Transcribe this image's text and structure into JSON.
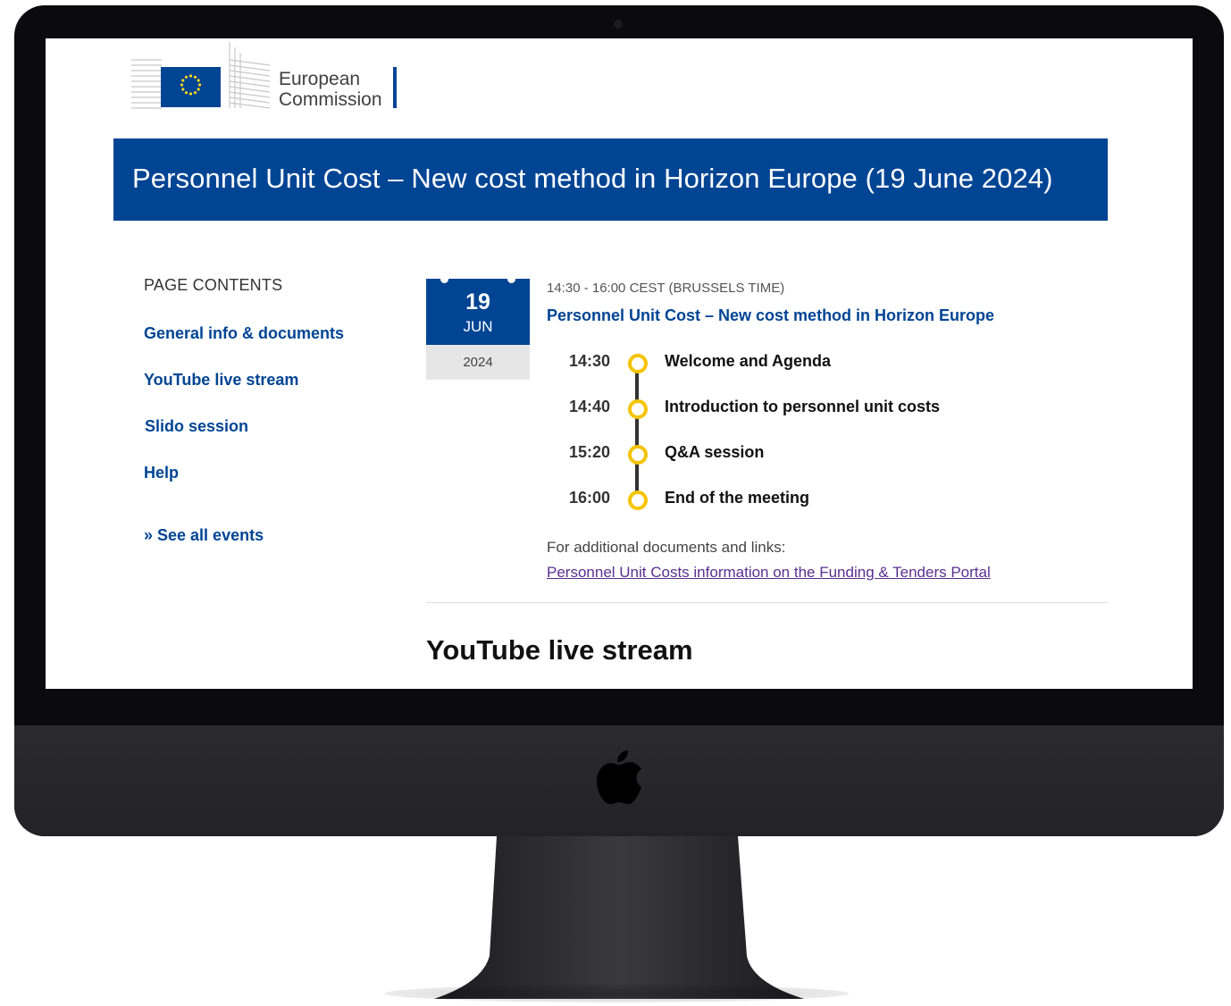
{
  "header": {
    "org_name_line1": "European",
    "org_name_line2": "Commission"
  },
  "banner": {
    "title": "Personnel Unit Cost – New cost method in Horizon Europe (19 June 2024)"
  },
  "sidebar": {
    "heading": "PAGE CONTENTS",
    "items": [
      {
        "label": "General info & documents"
      },
      {
        "label": "YouTube live stream"
      },
      {
        "label": "Slido session"
      },
      {
        "label": "Help"
      }
    ],
    "see_all": "» See all events"
  },
  "event": {
    "date": {
      "day": "19",
      "month": "JUN",
      "year": "2024"
    },
    "time": "14:30 - 16:00 CEST (BRUSSELS TIME)",
    "title": "Personnel Unit Cost – New cost method in Horizon Europe",
    "agenda": [
      {
        "time": "14:30",
        "label": "Welcome and Agenda"
      },
      {
        "time": "14:40",
        "label": "Introduction to personnel unit costs"
      },
      {
        "time": "15:20",
        "label": "Q&A session"
      },
      {
        "time": "16:00",
        "label": "End of the meeting"
      }
    ],
    "additional_text": "For additional documents and links:",
    "additional_link": "Personnel Unit Costs information on the Funding & Tenders Portal"
  },
  "sections": {
    "youtube_title": "YouTube live stream"
  },
  "colors": {
    "brand_blue": "#004494",
    "agenda_dot": "#f5c400",
    "visited_link": "#5a2f8f"
  },
  "icons": {
    "eu_flag": "eu-flag-icon",
    "apple": "apple-logo-icon"
  }
}
